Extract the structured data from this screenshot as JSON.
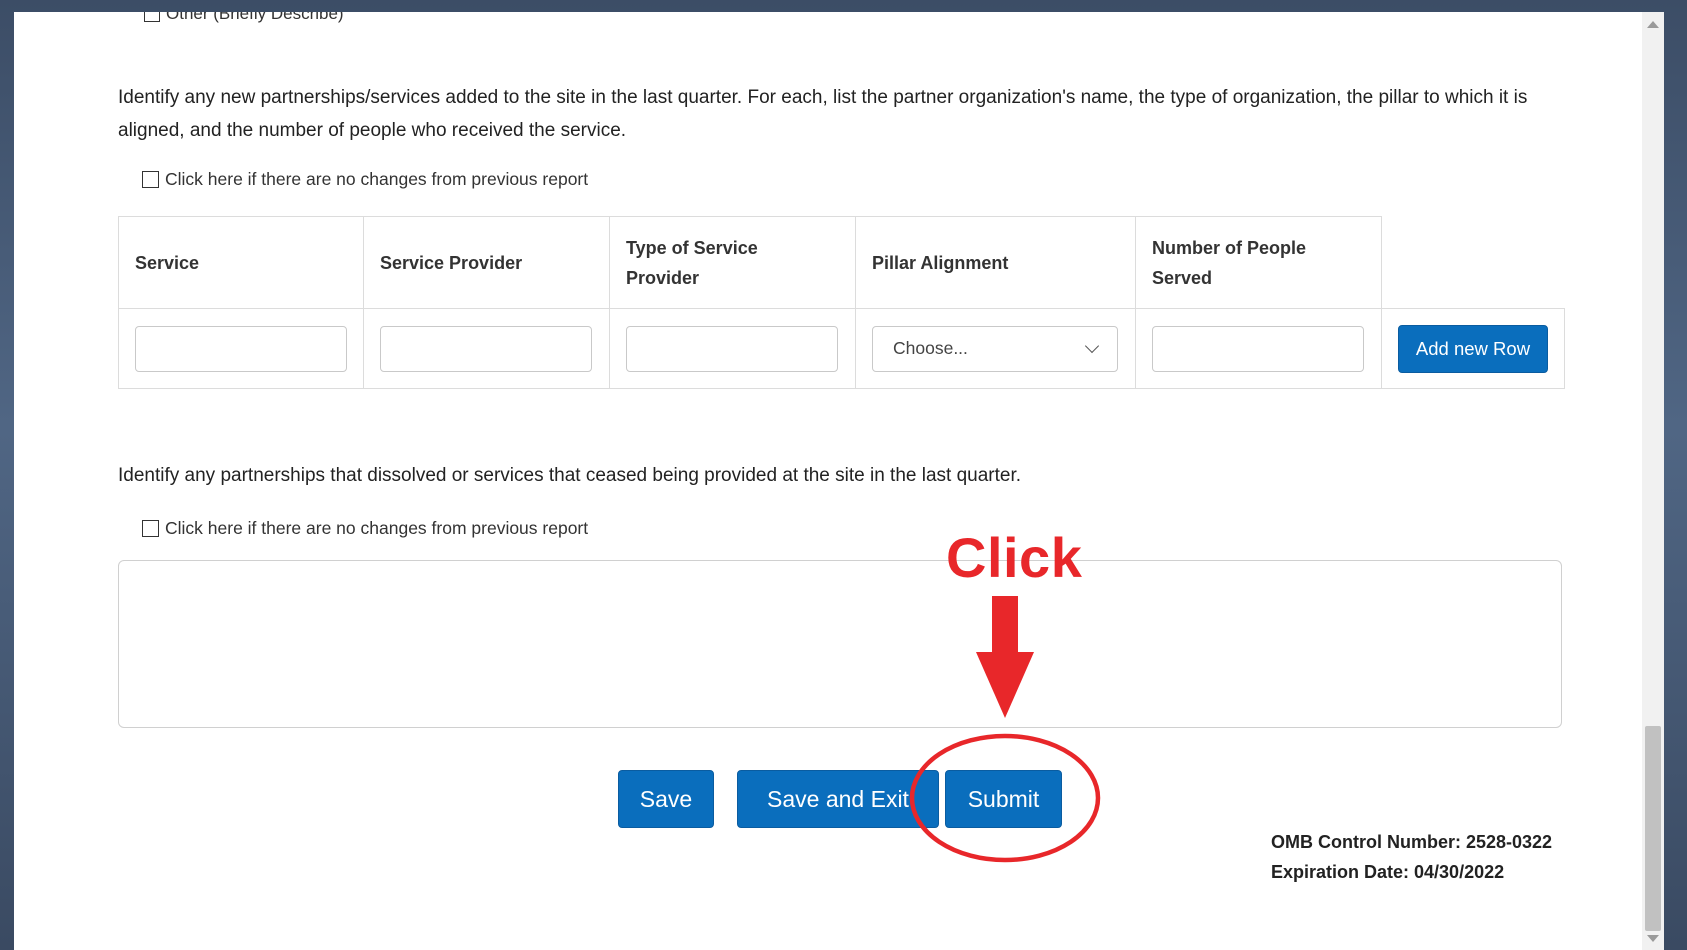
{
  "top_truncated_option": "Other (Briefly Describe)",
  "section1": {
    "instructions": "Identify any new partnerships/services added to the site in the last quarter. For each, list the partner organization's name, the type of organization, the pillar to which it is aligned, and the number of people who received the service.",
    "no_changes_label": "Click here if there are no changes from previous report"
  },
  "table": {
    "headers": [
      "Service",
      "Service Provider",
      "Type of Service Provider",
      "Pillar Alignment",
      "Number of People Served"
    ],
    "pillar_select_value": "Choose...",
    "add_row_label": "Add new Row"
  },
  "section2": {
    "instructions": "Identify any partnerships that dissolved or services that ceased being provided at the site in the last quarter.",
    "no_changes_label": "Click here if there are no changes from previous report"
  },
  "actions": {
    "save": "Save",
    "save_and_exit": "Save and Exit",
    "submit": "Submit"
  },
  "footer": {
    "omb_control": "OMB Control Number: 2528-0322",
    "expiration": "Expiration Date: 04/30/2022"
  },
  "annotation": {
    "label": "Click",
    "color": "#e8272a"
  },
  "colors": {
    "primary_button": "#0a6ebd"
  }
}
